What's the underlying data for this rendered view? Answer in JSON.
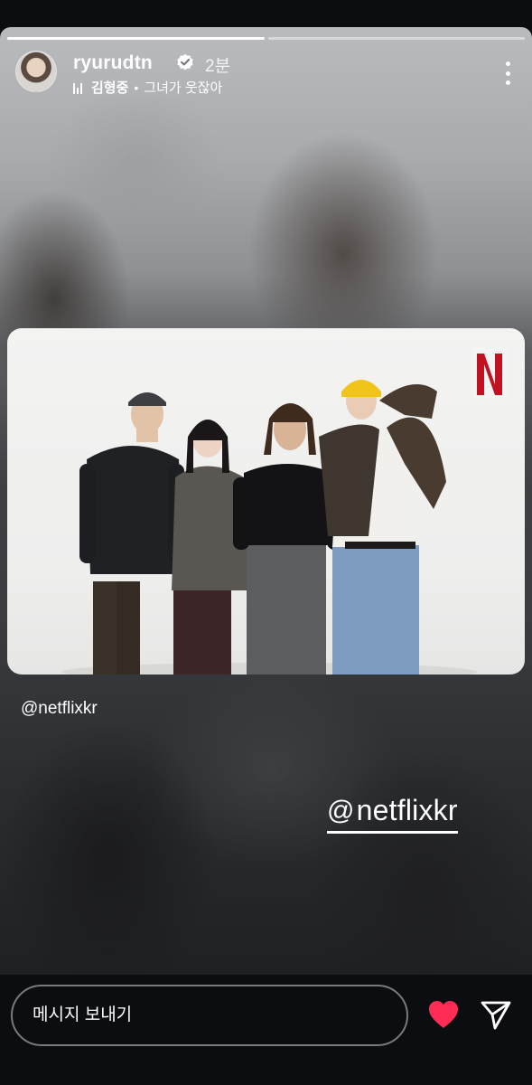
{
  "story": {
    "progress": [
      1.0,
      0.0
    ]
  },
  "header": {
    "username": "ryurudtn",
    "time": "2분",
    "music_artist": "김형중",
    "music_separator": "•",
    "music_title": "그녀가 웃잖아"
  },
  "post": {
    "caption": "@netflixkr",
    "mention_sticker": "@netflixkr",
    "mention_icon": "threads-icon",
    "brand_badge": "N",
    "brand_color": "#c01220"
  },
  "bottom": {
    "message_placeholder": "메시지 보내기",
    "heart_color": "#ff2d55"
  }
}
